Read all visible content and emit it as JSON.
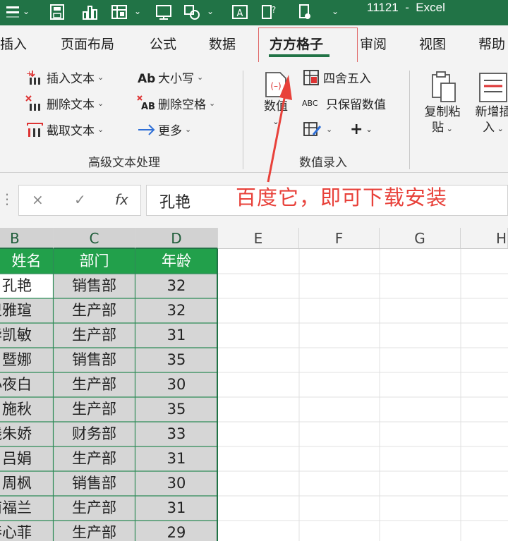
{
  "titlebar": {
    "title": "11121  -  Excel",
    "quick_access": [
      "menu-icon",
      "save-icon",
      "chart-icon",
      "table-icon",
      "screen-icon",
      "shapes-icon",
      "text-box-icon",
      "help-doc-icon",
      "touch-doc-icon",
      "customize-icon"
    ]
  },
  "tabs": [
    {
      "label": "插入"
    },
    {
      "label": "页面布局"
    },
    {
      "label": "公式"
    },
    {
      "label": "数据"
    },
    {
      "label": "方方格子"
    },
    {
      "label": "审阅"
    },
    {
      "label": "视图"
    },
    {
      "label": "帮助"
    }
  ],
  "ribbon": {
    "text_group": {
      "items": [
        {
          "label": "插入文本"
        },
        {
          "label": "删除文本"
        },
        {
          "label": "截取文本"
        },
        {
          "label": "大小写"
        },
        {
          "label": "删除空格"
        },
        {
          "label": "更多"
        }
      ],
      "group_label": "高级文本处理"
    },
    "number_group": {
      "big_label": "数值",
      "items": [
        {
          "label": "四舍五入"
        },
        {
          "label": "只保留数值"
        }
      ],
      "abc_text": "ABC",
      "group_label": "数值录入"
    },
    "copy_paste": {
      "line1": "复制粘",
      "line2": "贴"
    },
    "new_insert": {
      "line1": "新增插",
      "line2": "入"
    }
  },
  "annotation": {
    "text": "百度它，即可下载安装",
    "color": "#e8413a"
  },
  "formula_bar": {
    "cancel": "×",
    "enter": "✓",
    "fx": "fx",
    "value": "孔艳"
  },
  "columns": [
    "B",
    "C",
    "D",
    "E",
    "F",
    "G",
    "H"
  ],
  "table": {
    "headers": [
      "姓名",
      "部门",
      "年龄"
    ],
    "rows": [
      {
        "name": "孔艳",
        "dept": "销售部",
        "age": "32"
      },
      {
        "name": "卫雅瑄",
        "dept": "生产部",
        "age": "32"
      },
      {
        "name": "毕凯敏",
        "dept": "生产部",
        "age": "31"
      },
      {
        "name": "暨娜",
        "dept": "销售部",
        "age": "35"
      },
      {
        "name": "小夜白",
        "dept": "生产部",
        "age": "30"
      },
      {
        "name": "施秋",
        "dept": "生产部",
        "age": "35"
      },
      {
        "name": "钱朱娇",
        "dept": "财务部",
        "age": "33"
      },
      {
        "name": "吕娟",
        "dept": "生产部",
        "age": "31"
      },
      {
        "name": "周枫",
        "dept": "销售部",
        "age": "30"
      },
      {
        "name": "南福兰",
        "dept": "生产部",
        "age": "31"
      },
      {
        "name": "秦心菲",
        "dept": "生产部",
        "age": "29"
      }
    ]
  },
  "colors": {
    "excel_green": "#217346",
    "header_green": "#22a04b",
    "selected_gray": "#d6d6d6"
  }
}
